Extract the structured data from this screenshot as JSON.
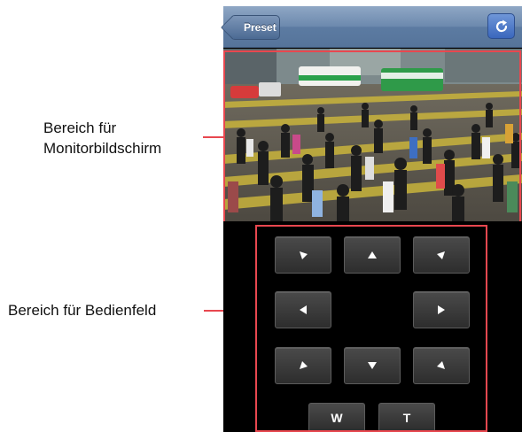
{
  "navbar": {
    "back_label": "Preset",
    "back_icon": "chevron-left-icon",
    "refresh_icon": "refresh-icon",
    "bar_color": "#6c89ae",
    "refresh_color": "#3a67bd"
  },
  "callouts": {
    "monitor_line1": "Bereich für",
    "monitor_line2": "Monitorbildschirm",
    "panel": "Bereich für Bedienfeld",
    "color": "#e8474f"
  },
  "monitor": {
    "content": "live-camera-image",
    "scene": "pedestrian crossing"
  },
  "control_panel": {
    "direction_buttons": [
      {
        "id": "up-left",
        "icon": "arrow-up-left-icon"
      },
      {
        "id": "up",
        "icon": "arrow-up-icon"
      },
      {
        "id": "up-right",
        "icon": "arrow-up-right-icon"
      },
      {
        "id": "left",
        "icon": "arrow-left-icon"
      },
      {
        "id": "right",
        "icon": "arrow-right-icon"
      },
      {
        "id": "down-left",
        "icon": "arrow-down-left-icon"
      },
      {
        "id": "down",
        "icon": "arrow-down-icon"
      },
      {
        "id": "down-right",
        "icon": "arrow-down-right-icon"
      }
    ],
    "zoom_wide_label": "W",
    "zoom_tele_label": "T"
  }
}
